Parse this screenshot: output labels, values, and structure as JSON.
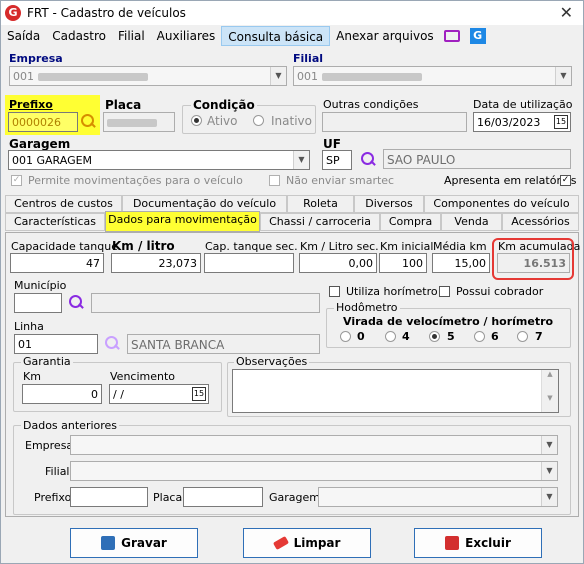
{
  "title": {
    "text": "FRT - Cadastro de veículos",
    "close": "✕"
  },
  "menu": [
    "Saída",
    "Cadastro",
    "Filial",
    "Auxiliares",
    "Consulta básica",
    "Anexar arquivos"
  ],
  "empresa": {
    "label": "Empresa",
    "value": "001"
  },
  "filial": {
    "label": "Filial",
    "value": "001"
  },
  "prefixo": {
    "label": "Prefixo",
    "value": "0000026"
  },
  "placa": {
    "label": "Placa"
  },
  "condicao": {
    "label": "Condição",
    "opt_ativo": "Ativo",
    "opt_inativo": "Inativo"
  },
  "outras": {
    "label": "Outras condições"
  },
  "data_util": {
    "label": "Data de utilização",
    "value": "16/03/2023"
  },
  "garagem": {
    "label": "Garagem",
    "value": "001 GARAGEM"
  },
  "uf": {
    "label": "UF",
    "value": "SP",
    "name": "SAO PAULO"
  },
  "checks": {
    "permite": "Permite movimentações para o veículo",
    "nao_enviar": "Não enviar smartec",
    "apresenta": "Apresenta em relatórios"
  },
  "tabs_row1": [
    "Centros de custos",
    "Documentação do veículo",
    "Roleta",
    "Diversos",
    "Componentes do veículo"
  ],
  "tabs_row2": [
    "Características",
    "Dados para movimentação",
    "Chassi / carroceria",
    "Compra",
    "Venda",
    "Acessórios"
  ],
  "mov": {
    "cap_tanque": {
      "label": "Capacidade tanque",
      "value": "47"
    },
    "km_litro": {
      "label": "Km / litro",
      "value": "23,073"
    },
    "cap_tanque_sec": {
      "label": "Cap. tanque sec.",
      "value": ""
    },
    "km_litro_sec": {
      "label": "Km / Litro sec.",
      "value": "0,00"
    },
    "km_inicial": {
      "label": "Km inicial",
      "value": "100"
    },
    "media_km": {
      "label": "Média km",
      "value": "15,00"
    },
    "km_acumulada": {
      "label": "Km acumulada",
      "value": "16.513"
    },
    "municipio": {
      "label": "Município"
    },
    "utiliza_horimetro": "Utiliza horímetro",
    "possui_cobrador": "Possui cobrador",
    "hodometro": {
      "label": "Hodômetro",
      "virada": "Virada de velocímetro / horímetro",
      "opts": [
        "0",
        "4",
        "5",
        "6",
        "7"
      ]
    },
    "linha": {
      "label": "Linha",
      "value": "01",
      "name": "SANTA BRANCA"
    },
    "garantia": {
      "label": "Garantia",
      "km_label": "Km",
      "km_value": "0",
      "venc_label": "Vencimento",
      "venc_value": "/ /"
    },
    "observacoes": "Observações",
    "anteriores": {
      "label": "Dados anteriores",
      "empresa": "Empresa",
      "filial": "Filial",
      "prefixo": "Prefixo",
      "placa": "Placa",
      "garagem": "Garagem"
    }
  },
  "buttons": {
    "gravar": "Gravar",
    "limpar": "Limpar",
    "excluir": "Excluir"
  }
}
